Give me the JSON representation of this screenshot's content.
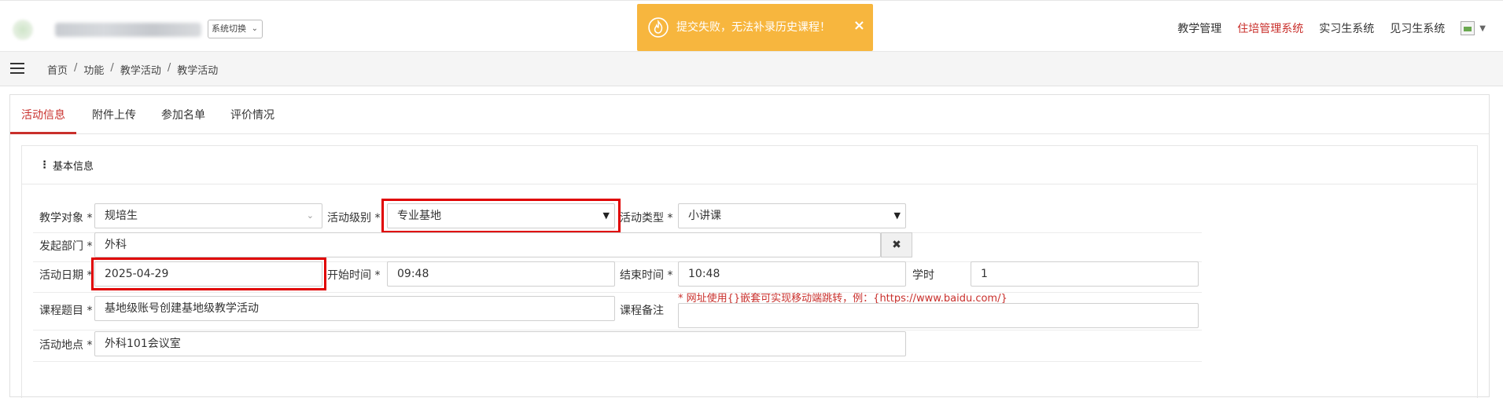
{
  "header": {
    "system_switch_label": "系统切换",
    "toast": {
      "message": "提交失败，无法补录历史课程！",
      "close": "×",
      "color": "#f7b63e"
    },
    "nav": [
      {
        "label": "教学管理"
      },
      {
        "label": "住培管理系统",
        "active": true
      },
      {
        "label": "实习生系统"
      },
      {
        "label": "见习生系统"
      }
    ]
  },
  "breadcrumb": {
    "items": [
      "首页",
      "功能",
      "教学活动",
      "教学活动"
    ],
    "separator": "/"
  },
  "tabs": [
    {
      "label": "活动信息",
      "active": true
    },
    {
      "label": "附件上传"
    },
    {
      "label": "参加名单"
    },
    {
      "label": "评价情况"
    }
  ],
  "section": {
    "title": "基本信息"
  },
  "form": {
    "target": {
      "label": "教学对象 *",
      "value": "规培生"
    },
    "level": {
      "label": "活动级别 *",
      "value": "专业基地"
    },
    "type": {
      "label": "活动类型 *",
      "value": "小讲课"
    },
    "department": {
      "label": "发起部门 *",
      "value": "外科",
      "clear": "✖"
    },
    "date": {
      "label": "活动日期 *",
      "value": "2025-04-29"
    },
    "start": {
      "label": "开始时间 *",
      "value": "09:48"
    },
    "end": {
      "label": "结束时间 *",
      "value": "10:48"
    },
    "hours": {
      "label": "学时",
      "value": "1"
    },
    "topic": {
      "label": "课程题目 *",
      "value": "基地级账号创建基地级教学活动"
    },
    "remark": {
      "label": "课程备注",
      "hint": "* 网址使用{}嵌套可实现移动端跳转，例：{https://www.baidu.com/}",
      "value": ""
    },
    "location": {
      "label": "活动地点 *",
      "value": "外科101会议室"
    }
  },
  "colors": {
    "accent": "#c9302c",
    "highlight": "#e00000",
    "toast": "#f7b63e"
  }
}
